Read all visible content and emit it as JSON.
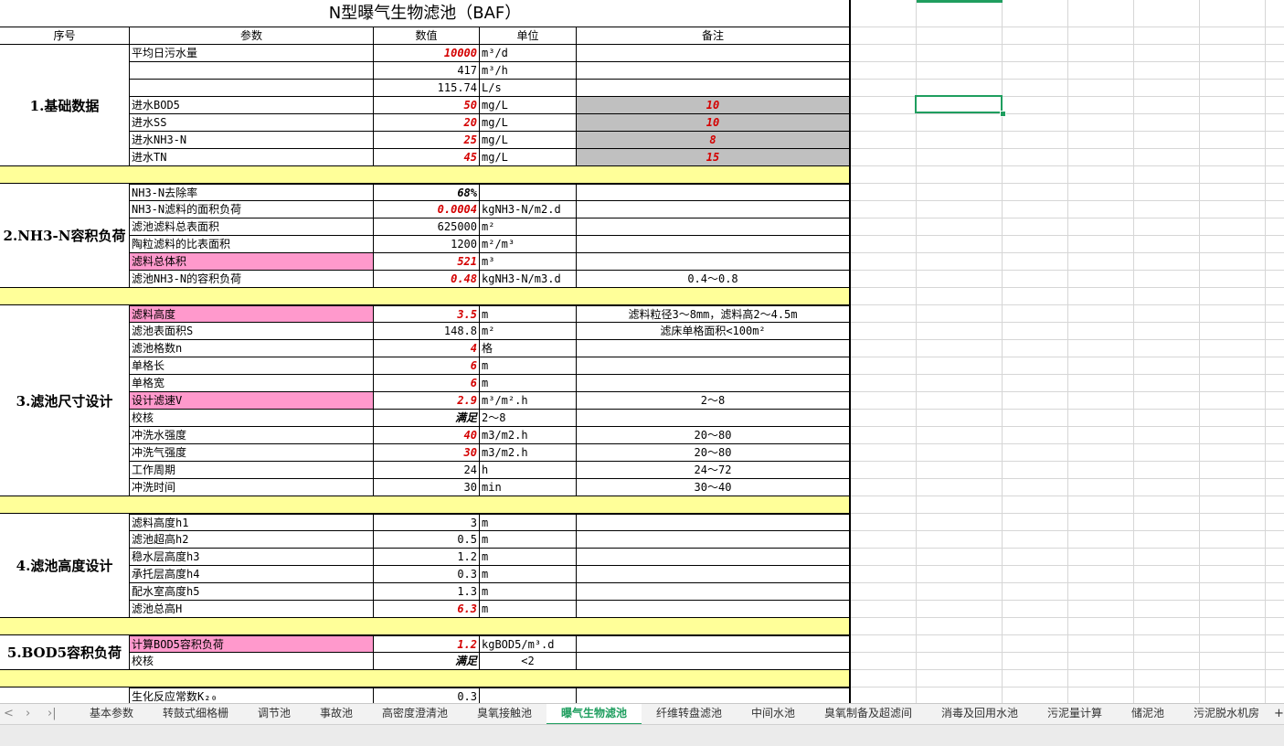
{
  "sheet": {
    "title": "N型曝气生物滤池（BAF）",
    "headers": {
      "no": "序号",
      "param": "参数",
      "value": "数值",
      "unit": "单位",
      "note": "备注"
    },
    "sections": [
      "1.基础数据",
      "2.NH3-N容积负荷",
      "3.滤池尺寸设计",
      "4.滤池高度设计",
      "5.BOD5容积负荷"
    ],
    "rows": [
      {
        "param": "平均日污水量",
        "value": "10000",
        "unit": "m³/d",
        "note": ""
      },
      {
        "param": "",
        "value": "417",
        "unit": "m³/h",
        "note": ""
      },
      {
        "param": "",
        "value": "115.74",
        "unit": "L/s",
        "note": ""
      },
      {
        "param": "进水BOD5",
        "value": "50",
        "unit": "mg/L",
        "note": "10"
      },
      {
        "param": "进水SS",
        "value": "20",
        "unit": "mg/L",
        "note": "10"
      },
      {
        "param": "进水NH3-N",
        "value": "25",
        "unit": "mg/L",
        "note": "8"
      },
      {
        "param": "进水TN",
        "value": "45",
        "unit": "mg/L",
        "note": "15"
      },
      {
        "param": "NH3-N去除率",
        "value": "68%",
        "unit": "",
        "note": ""
      },
      {
        "param": "NH3-N滤料的面积负荷",
        "value": "0.0004",
        "unit": "kgNH3-N/m2.d",
        "note": ""
      },
      {
        "param": "滤池滤料总表面积",
        "value": "625000",
        "unit": "m²",
        "note": ""
      },
      {
        "param": "陶粒滤料的比表面积",
        "value": "1200",
        "unit": "m²/m³",
        "note": ""
      },
      {
        "param": "滤料总体积",
        "value": "521",
        "unit": "m³",
        "note": ""
      },
      {
        "param": "滤池NH3-N的容积负荷",
        "value": "0.48",
        "unit": "kgNH3-N/m3.d",
        "note": "0.4～0.8"
      },
      {
        "param": "滤料高度",
        "value": "3.5",
        "unit": "m",
        "note": "滤料粒径3～8mm，滤料高2～4.5m"
      },
      {
        "param": "滤池表面积S",
        "value": "148.8",
        "unit": "m²",
        "note": "滤床单格面积<100m²"
      },
      {
        "param": "滤池格数n",
        "value": "4",
        "unit": "格",
        "note": ""
      },
      {
        "param": "单格长",
        "value": "6",
        "unit": "m",
        "note": ""
      },
      {
        "param": "单格宽",
        "value": "6",
        "unit": "m",
        "note": ""
      },
      {
        "param": "设计滤速V",
        "value": "2.9",
        "unit": "m³/m².h",
        "note": "2～8"
      },
      {
        "param": "校核",
        "value": "满足",
        "unit": "2～8",
        "note": ""
      },
      {
        "param": "冲洗水强度",
        "value": "40",
        "unit": "m3/m2.h",
        "note": "20～80"
      },
      {
        "param": "冲洗气强度",
        "value": "30",
        "unit": "m3/m2.h",
        "note": "20～80"
      },
      {
        "param": "工作周期",
        "value": "24",
        "unit": "h",
        "note": "24～72"
      },
      {
        "param": "冲洗时间",
        "value": "30",
        "unit": "min",
        "note": "30～40"
      },
      {
        "param": "滤料高度h1",
        "value": "3",
        "unit": "m",
        "note": ""
      },
      {
        "param": "滤池超高h2",
        "value": "0.5",
        "unit": "m",
        "note": ""
      },
      {
        "param": "稳水层高度h3",
        "value": "1.2",
        "unit": "m",
        "note": ""
      },
      {
        "param": "承托层高度h4",
        "value": "0.3",
        "unit": "m",
        "note": ""
      },
      {
        "param": "配水室高度h5",
        "value": "1.3",
        "unit": "m",
        "note": ""
      },
      {
        "param": "滤池总高H",
        "value": "6.3",
        "unit": "m",
        "note": ""
      },
      {
        "param": "计算BOD5容积负荷",
        "value": "1.2",
        "unit": "kgBOD5/m³.d",
        "note": ""
      },
      {
        "param": "校核",
        "value": "满足",
        "unit": "<2",
        "note": ""
      },
      {
        "param": "生化反应常数K₂₀",
        "value": "0.3",
        "unit": "",
        "note": ""
      }
    ]
  },
  "tabs": {
    "items": [
      "基本参数",
      "转鼓式细格栅",
      "调节池",
      "事故池",
      "高密度澄清池",
      "臭氧接触池",
      "曝气生物滤池",
      "纤维转盘滤池",
      "中间水池",
      "臭氧制备及超滤间",
      "消毒及回用水池",
      "污泥量计算",
      "储泥池",
      "污泥脱水机房"
    ],
    "active": "曝气生物滤池"
  },
  "nav": {
    "prev": "‹",
    "next": "›",
    "last": "›|",
    "first": "<",
    "add": "+"
  },
  "colors": {
    "accent": "#1f9e5f",
    "pink": "#ff99cc",
    "gray": "#c0c0c0",
    "yellow": "#ffff99",
    "red_value": "#d40000"
  }
}
